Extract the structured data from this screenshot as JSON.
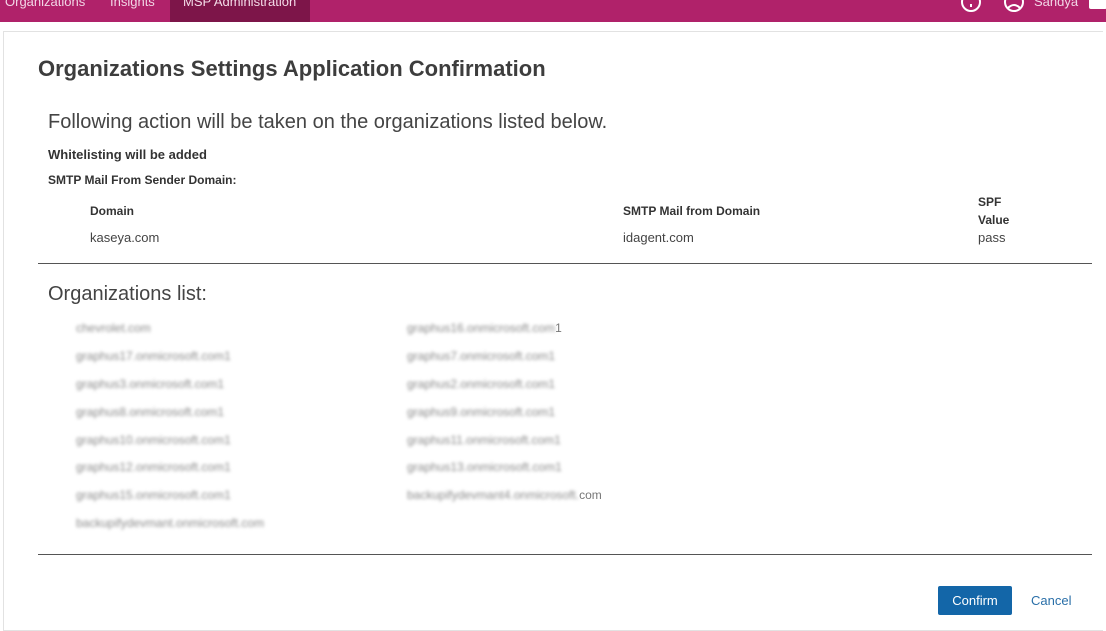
{
  "nav": {
    "items": [
      {
        "label": "Organizations",
        "active": false
      },
      {
        "label": "Insights",
        "active": false
      },
      {
        "label": "MSP Administration",
        "active": true
      }
    ],
    "user_label": "Sandya",
    "colors": {
      "bar": "#b0226a",
      "active": "#7d1549"
    },
    "icons": [
      "help-icon",
      "user-icon"
    ]
  },
  "dialog": {
    "title": "Organizations Settings Application Confirmation",
    "lead": "Following action will be taken on the organizations listed below.",
    "action": "Whitelisting will be added",
    "section": "SMTP Mail From Sender Domain:",
    "table": {
      "headers": {
        "domain": "Domain",
        "smtp": "SMTP Mail from Domain",
        "spf_1": "SPF",
        "spf_2": "Value"
      },
      "rows": [
        {
          "domain": "kaseya.com",
          "smtp": "idagent.com",
          "spf": "pass"
        }
      ]
    },
    "org_heading": "Organizations list:",
    "orgs_col1": [
      {
        "blurred": "chevrolet.com",
        "visible": ""
      },
      {
        "blurred": "graphus17.onmicrosoft.com1",
        "visible": ""
      },
      {
        "blurred": "graphus3.onmicrosoft.com1",
        "visible": ""
      },
      {
        "blurred": "graphus8.onmicrosoft.com1",
        "visible": ""
      },
      {
        "blurred": "graphus10.onmicrosoft.com1",
        "visible": ""
      },
      {
        "blurred": "graphus12.onmicrosoft.com1",
        "visible": ""
      },
      {
        "blurred": "graphus15.onmicrosoft.com1",
        "visible": ""
      },
      {
        "blurred": "backupifydevmant.onmicrosoft.com",
        "visible": ""
      }
    ],
    "orgs_col2": [
      {
        "blurred": "graphus16.onmicrosoft.com",
        "visible": "1"
      },
      {
        "blurred": "graphus7.onmicrosoft.com1",
        "visible": ""
      },
      {
        "blurred": "graphus2.onmicrosoft.com1",
        "visible": ""
      },
      {
        "blurred": "graphus9.onmicrosoft.com1",
        "visible": ""
      },
      {
        "blurred": "graphus11.onmicrosoft.com1",
        "visible": ""
      },
      {
        "blurred": "graphus13.onmicrosoft.com1",
        "visible": ""
      },
      {
        "blurred": "backupifydevmant4.onmicrosoft.",
        "visible": "com"
      }
    ],
    "buttons": {
      "confirm": "Confirm",
      "cancel": "Cancel"
    },
    "colors": {
      "confirm_bg": "#1366a8",
      "cancel_text": "#2a6fa8"
    }
  }
}
